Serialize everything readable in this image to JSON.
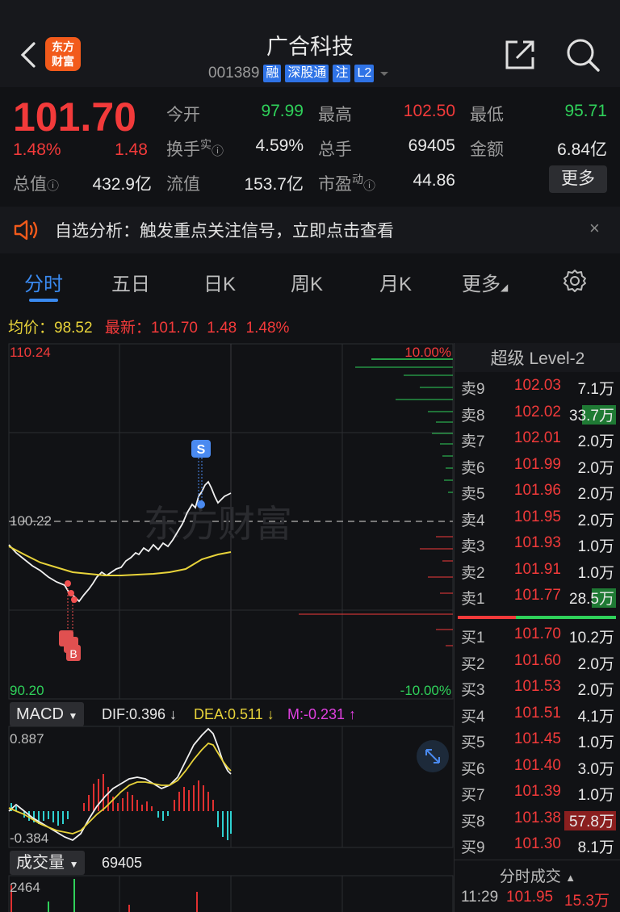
{
  "header": {
    "logo_line1": "东方",
    "logo_line2": "财富",
    "title": "广合科技",
    "code": "001389",
    "tags": [
      "融",
      "深股通",
      "注",
      "L2"
    ]
  },
  "quote": {
    "price": "101.70",
    "change_pct": "1.48%",
    "change": "1.48",
    "fields": {
      "open_label": "今开",
      "open": "97.99",
      "high_label": "最高",
      "high": "102.50",
      "low_label": "最低",
      "low": "95.71",
      "turnover_label": "换手",
      "turnover_sup": "实",
      "turnover": "4.59%",
      "volume_label": "总手",
      "volume": "69405",
      "amount_label": "金额",
      "amount": "6.84亿",
      "mcap_label": "总值",
      "mcap": "432.9亿",
      "float_label": "流值",
      "float": "153.7亿",
      "pe_label": "市盈",
      "pe_sup": "动",
      "pe": "44.86"
    },
    "more_button": "更多"
  },
  "notice": {
    "text": "自选分析：触发重点关注信号，立即点击查看",
    "close": "×"
  },
  "tabs": [
    "分时",
    "五日",
    "日K",
    "周K",
    "月K",
    "更多"
  ],
  "avg_line": {
    "avg_label": "均价：",
    "avg": "98.52",
    "latest_label": "最新：",
    "latest": "101.70",
    "chg": "1.48",
    "chg_pct": "1.48%"
  },
  "chart_labels": {
    "top_price": "110.24",
    "mid_price": "100.22",
    "bottom_price": "90.20",
    "top_pct": "10.00%",
    "bottom_pct": "-10.00%",
    "watermark": "东方财富",
    "sell_marker": "S",
    "buy_marker": "B"
  },
  "macd": {
    "selector": "MACD",
    "dif": "DIF:0.396 ↓",
    "dea": "DEA:0.511 ↓",
    "m": "M:-0.231 ↑",
    "top": "0.887",
    "bottom": "-0.384"
  },
  "volume_panel": {
    "selector": "成交量",
    "value": "69405",
    "top": "2464"
  },
  "orderbook": {
    "title": "超级 Level-2",
    "asks": [
      {
        "label": "卖9",
        "price": "102.03",
        "vol": "7.1万"
      },
      {
        "label": "卖8",
        "price": "102.02",
        "vol": "33.7万"
      },
      {
        "label": "卖7",
        "price": "102.01",
        "vol": "2.0万"
      },
      {
        "label": "卖6",
        "price": "101.99",
        "vol": "2.0万"
      },
      {
        "label": "卖5",
        "price": "101.96",
        "vol": "2.0万"
      },
      {
        "label": "卖4",
        "price": "101.95",
        "vol": "2.0万"
      },
      {
        "label": "卖3",
        "price": "101.93",
        "vol": "1.0万"
      },
      {
        "label": "卖2",
        "price": "101.91",
        "vol": "1.0万"
      },
      {
        "label": "卖1",
        "price": "101.77",
        "vol": "28.5万"
      }
    ],
    "bids": [
      {
        "label": "买1",
        "price": "101.70",
        "vol": "10.2万"
      },
      {
        "label": "买2",
        "price": "101.60",
        "vol": "2.0万"
      },
      {
        "label": "买3",
        "price": "101.53",
        "vol": "2.0万"
      },
      {
        "label": "买4",
        "price": "101.51",
        "vol": "4.1万"
      },
      {
        "label": "买5",
        "price": "101.45",
        "vol": "1.0万"
      },
      {
        "label": "买6",
        "price": "101.40",
        "vol": "3.0万"
      },
      {
        "label": "买7",
        "price": "101.39",
        "vol": "1.0万"
      },
      {
        "label": "买8",
        "price": "101.38",
        "vol": "57.8万"
      },
      {
        "label": "买9",
        "price": "101.30",
        "vol": "8.1万"
      }
    ],
    "trades_title": "分时成交",
    "last_trade": {
      "time": "11:29",
      "price": "101.95",
      "vol": "15.3万"
    }
  },
  "colors": {
    "up": "#f23a3a",
    "down": "#2fd15a",
    "accent": "#3a8af0",
    "avg": "#e8d33a"
  }
}
